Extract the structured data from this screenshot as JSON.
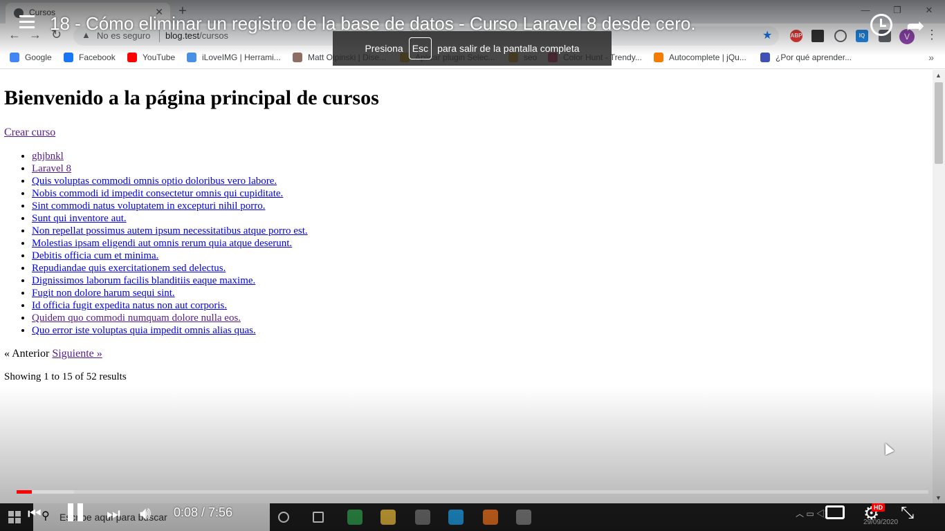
{
  "browser": {
    "tab_title": "Cursos",
    "omnibox": {
      "security_label": "No es seguro",
      "host": "blog.test",
      "path": "/cursos"
    },
    "bookmarks": [
      {
        "label": "Google",
        "icon": "google-icon",
        "color": "#4285f4"
      },
      {
        "label": "Facebook",
        "icon": "facebook-icon",
        "color": "#1877f2"
      },
      {
        "label": "YouTube",
        "icon": "youtube-icon",
        "color": "#ff0000"
      },
      {
        "label": "iLoveIMG | Herrami...",
        "icon": "heart-icon",
        "color": "#4a90e2"
      },
      {
        "label": "Matt Olpinski | Dise...",
        "icon": "avatar-icon",
        "color": "#8d6e63"
      },
      {
        "label": "Aplicar plugin Selec...",
        "icon": "folder-icon",
        "color": "#e0a800"
      },
      {
        "label": "seo",
        "icon": "folder-icon",
        "color": "#e0a800"
      },
      {
        "label": "Color Hunt - Trendy...",
        "icon": "colorhunt-icon",
        "color": "#e91e63"
      },
      {
        "label": "Autocomplete | jQu...",
        "icon": "shield-icon",
        "color": "#f57c00"
      },
      {
        "label": "¿Por qué aprender...",
        "icon": "grid-icon",
        "color": "#3f51b5"
      }
    ],
    "profile_initial": "V"
  },
  "page": {
    "heading": "Bienvenido a la página principal de cursos",
    "create_link": "Crear curso",
    "courses": [
      {
        "label": "ghjbnkl",
        "visited": true
      },
      {
        "label": "Laravel 8",
        "visited": true
      },
      {
        "label": "Quis voluptas commodi omnis optio doloribus vero labore.",
        "visited": false
      },
      {
        "label": "Nobis commodi id impedit consectetur omnis qui cupiditate.",
        "visited": false
      },
      {
        "label": "Sint commodi natus voluptatem in excepturi nihil porro.",
        "visited": false
      },
      {
        "label": "Sunt qui inventore aut.",
        "visited": false
      },
      {
        "label": "Non repellat possimus autem ipsum necessitatibus atque porro est.",
        "visited": false
      },
      {
        "label": "Molestias ipsam eligendi aut omnis rerum quia atque deserunt.",
        "visited": false
      },
      {
        "label": "Debitis officia cum et minima.",
        "visited": false
      },
      {
        "label": "Repudiandae quis exercitationem sed delectus.",
        "visited": false
      },
      {
        "label": "Dignissimos laborum facilis blanditiis eaque maxime.",
        "visited": false
      },
      {
        "label": "Fugit non dolore harum sequi sint.",
        "visited": false
      },
      {
        "label": "Id officia fugit expedita natus non aut corporis.",
        "visited": false
      },
      {
        "label": "Quidem quo commodi numquam dolore nulla eos.",
        "visited": true
      },
      {
        "label": "Quo error iste voluptas quia impedit omnis alias quas.",
        "visited": false
      }
    ],
    "pagination": {
      "prev": "« Anterior",
      "next": "Siguiente »"
    },
    "results_text": "Showing 1 to 15 of 52 results"
  },
  "player": {
    "title": "18 - Cómo eliminar un registro de la base de datos - Curso Laravel 8 desde cero.",
    "esc_toast": {
      "before": "Presiona",
      "key": "Esc",
      "after": "para salir de la pantalla completa"
    },
    "time": "0:08 / 7:56",
    "played_fraction": 0.0168,
    "buffered_fraction": 0.063,
    "quality_badge": "HD",
    "colors": {
      "progress": "#ff0000"
    }
  },
  "taskbar": {
    "search_placeholder": "Escribe aquí para buscar",
    "date": "29/09/2020",
    "apps": [
      {
        "icon": "cortana-icon",
        "color": "#ffffff"
      },
      {
        "icon": "taskview-icon",
        "color": "#ffffff"
      },
      {
        "icon": "chrome-icon",
        "color": "#34a853"
      },
      {
        "icon": "file-explorer-icon",
        "color": "#f4c542"
      },
      {
        "icon": "sublime-icon",
        "color": "#7a7a7a"
      },
      {
        "icon": "vscode-icon",
        "color": "#23a9f2"
      },
      {
        "icon": "xampp-icon",
        "color": "#fb7a24"
      },
      {
        "icon": "laravel-app-icon",
        "color": "#888888"
      }
    ]
  }
}
